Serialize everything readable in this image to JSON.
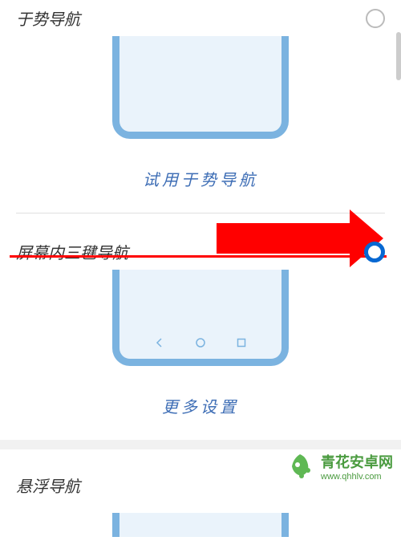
{
  "options": {
    "gesture": {
      "label": "于势导航",
      "selected": false,
      "try_link": "试用于势导航"
    },
    "three_key": {
      "label": "屏幕内三毽导航",
      "selected": true,
      "more_link": "更多设置"
    },
    "floating": {
      "label": "悬浮导航"
    }
  },
  "watermark": {
    "name": "青花安卓网",
    "url": "www.qhhlv.com"
  },
  "colors": {
    "accent": "#0768d2",
    "phone_frame": "#7bb3e0",
    "link": "#3d6db5",
    "annotation": "#ff0000",
    "watermark": "#4a9b3f"
  }
}
